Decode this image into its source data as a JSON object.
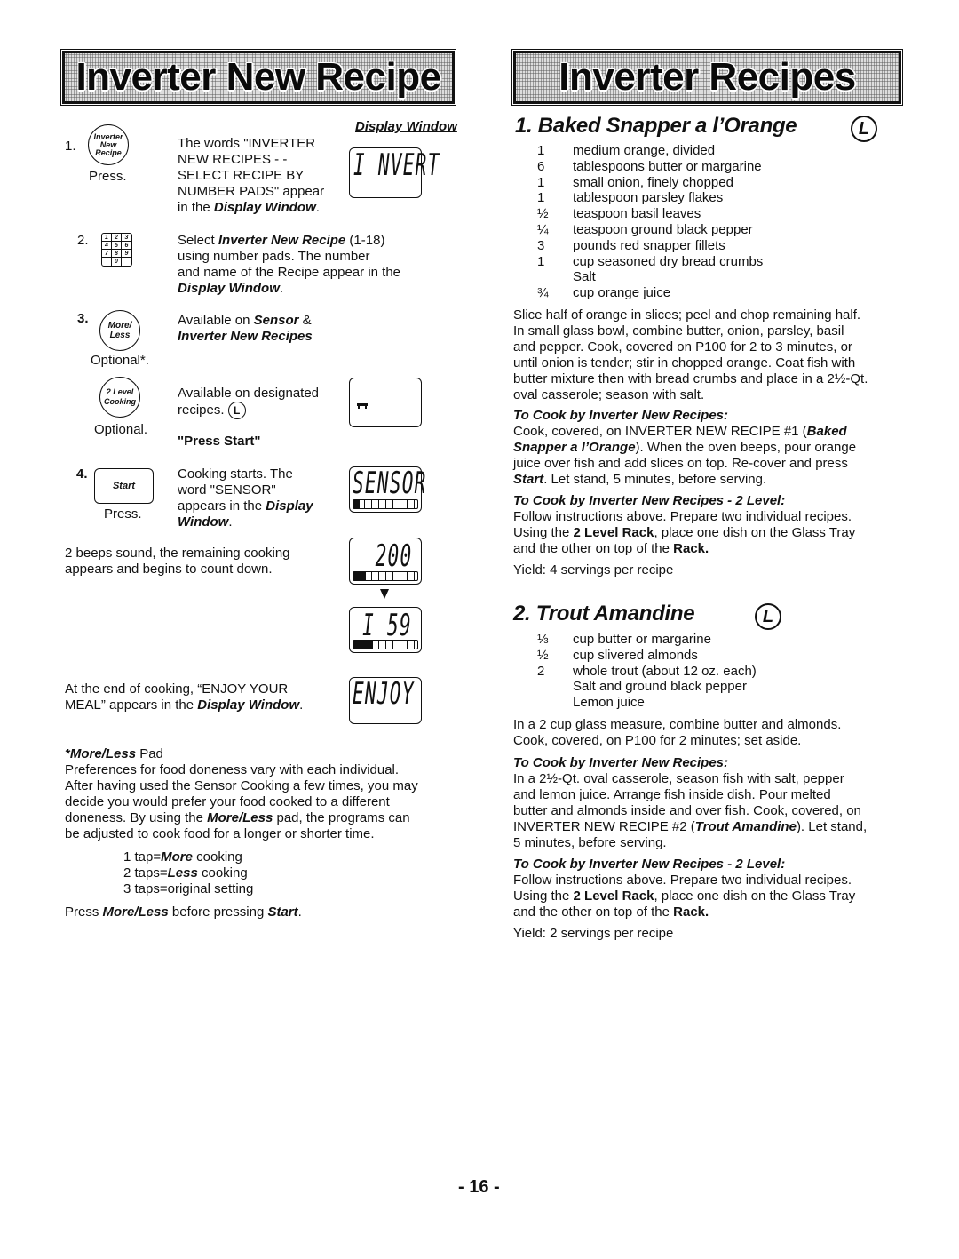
{
  "page_number": "- 16 -",
  "left": {
    "banner_title": "Inverter New Recipe",
    "display_window_heading": "Display Window",
    "steps": [
      {
        "number": "1.",
        "button_label_lines": [
          "Inverter",
          "New",
          "Recipe"
        ],
        "action": "Press.",
        "text_lines": [
          "The words \"INVERTER",
          "NEW RECIPES - -",
          "SELECT RECIPE BY",
          "NUMBER PADS\" appear"
        ],
        "text_tail_prefix": "in the ",
        "text_tail_emph": "Display Window",
        "text_tail_suffix": ".",
        "display": "I NVERT"
      },
      {
        "number": "2.",
        "keypad_keys": [
          "1",
          "2",
          "3",
          "4",
          "5",
          "6",
          "7",
          "8",
          "9",
          "",
          "0",
          ""
        ],
        "line1_prefix": "Select ",
        "line1_emph": "Inverter New Recipe",
        "line1_suffix": " (1-18)",
        "line2": "using number pads. The number",
        "line3": "and name of the Recipe appear in the",
        "line4_emph": "Display Window",
        "line4_suffix": "."
      },
      {
        "number": "3.",
        "button_label_lines": [
          "More/",
          "Less"
        ],
        "action": "Optional*.",
        "line1_prefix": "Available on ",
        "line1_emph": "Sensor",
        "line1_suffix": " &",
        "line2_emph": "Inverter New Recipes"
      },
      {
        "button_label_lines": [
          "2 Level",
          "Cooking"
        ],
        "action": "Optional.",
        "line1": "Available on designated",
        "line2": "recipes.",
        "icon": "L",
        "press_start": "\"Press Start\""
      },
      {
        "number": "4.",
        "button_label": "Start",
        "action": "Press.",
        "line1": "Cooking starts. The",
        "line2": "word \"SENSOR\"",
        "line3_prefix": "appears in the ",
        "line3_emph": "Display",
        "line4_emph": "Window",
        "line4_suffix": ".",
        "display": "SENSOR",
        "progress_fraction": 0.1
      }
    ],
    "countdown": {
      "line1": "2 beeps sound, the remaining cooking",
      "line2": "appears and begins to count down.",
      "display_first": "200",
      "display_first_progress": 0.2,
      "display_second": "I 59",
      "display_second_progress": 0.3
    },
    "end": {
      "line1": "At the end of cooking, “ENJOY YOUR",
      "line2_prefix": "MEAL” appears in the ",
      "line2_emph": "Display Window",
      "line2_suffix": ".",
      "display": "ENJOY"
    },
    "more_less": {
      "heading_emph": "*More/Less",
      "heading_suffix": " Pad",
      "para_lines": [
        "Preferences for food doneness vary with each individual.",
        "After having used the Sensor Cooking a few times, you may",
        "decide you would prefer your food cooked to a different"
      ],
      "para_line4_prefix": "doneness. By using the ",
      "para_line4_emph": "More/Less",
      "para_line4_suffix": " pad, the programs can",
      "para_line5": "be adjusted to cook food for a longer or shorter time.",
      "taps": [
        {
          "prefix": "1 tap=",
          "emph": "More",
          "suffix": " cooking"
        },
        {
          "prefix": "2 taps=",
          "emph": "Less",
          "suffix": " cooking"
        },
        {
          "prefix": "3 taps=original setting",
          "emph": "",
          "suffix": ""
        }
      ],
      "footer_prefix": "Press ",
      "footer_emph1": "More/Less",
      "footer_mid": " before pressing ",
      "footer_emph2": "Start",
      "footer_suffix": "."
    }
  },
  "right": {
    "banner_title": "Inverter Recipes",
    "recipes": [
      {
        "title": "1. Baked Snapper a l’Orange",
        "icon": "L",
        "ingredients": [
          {
            "qty": "1",
            "item": "medium orange, divided"
          },
          {
            "qty": "6",
            "item": "tablespoons butter or margarine"
          },
          {
            "qty": "1",
            "item": "small onion, finely chopped"
          },
          {
            "qty": "1",
            "item": "tablespoon parsley flakes"
          },
          {
            "qty": "½",
            "item": "teaspoon basil leaves"
          },
          {
            "qty": "¼",
            "item": "teaspoon ground black pepper"
          },
          {
            "qty": "3",
            "item": "pounds red snapper fillets"
          },
          {
            "qty": "1",
            "item": "cup seasoned dry bread crumbs"
          },
          {
            "qty": "",
            "item": "Salt"
          },
          {
            "qty": "¾",
            "item": "cup orange juice"
          }
        ],
        "directions": [
          "Slice half of orange in slices; peel and chop remaining half.",
          "In small glass bowl, combine butter, onion, parsley, basil",
          "and pepper. Cook, covered on P100 for 2 to 3 minutes, or",
          "until onion is tender; stir in chopped orange. Coat fish with",
          "butter mixture then with bread crumbs and place in a 2½-Qt.",
          "oval casserole; season with salt."
        ],
        "cook_heading": "To Cook by Inverter New Recipes:",
        "cook_line1_prefix": "Cook, covered, on INVERTER NEW RECIPE #1 (",
        "cook_line1_emph": "Baked",
        "cook_line2_emph": "Snapper a l’Orange",
        "cook_line2_suffix": ").  When the oven beeps, pour orange",
        "cook_line3": "juice over fish and add slices on top.  Re-cover and press",
        "cook_line4_emph": "Start",
        "cook_line4_suffix": ".  Let stand, 5 minutes, before serving.",
        "level_heading": "To Cook by Inverter New Recipes - 2 Level:",
        "level_line1": "Follow instructions above. Prepare two individual recipes.",
        "level_line2_prefix": "Using the ",
        "level_line2_emph": "2 Level Rack",
        "level_line2_suffix": ", place one dish on the Glass Tray",
        "level_line3_prefix": "and the other on top of the ",
        "level_line3_emph": "Rack.",
        "yield": "Yield: 4 servings per recipe"
      },
      {
        "title": "2. Trout Amandine",
        "icon": "L",
        "ingredients": [
          {
            "qty": "⅓",
            "item": "cup butter or margarine"
          },
          {
            "qty": "½",
            "item": "cup slivered almonds"
          },
          {
            "qty": "2",
            "item": "whole trout (about 12 oz. each)"
          },
          {
            "qty": "",
            "item": "Salt and ground black pepper"
          },
          {
            "qty": "",
            "item": "Lemon juice"
          }
        ],
        "directions": [
          "In a 2 cup glass measure, combine butter and almonds.",
          "Cook, covered, on P100 for 2 minutes; set aside."
        ],
        "cook_heading": "To Cook by Inverter New Recipes:",
        "cook_lines": [
          "In a 2½-Qt. oval casserole, season fish with salt, pepper",
          "and lemon juice.  Arrange fish inside dish.  Pour melted",
          "butter and almonds inside and over fish. Cook, covered, on"
        ],
        "cook_line4_prefix": "INVERTER NEW RECIPE #2 (",
        "cook_line4_emph": "Trout Amandine",
        "cook_line4_suffix": "). Let stand,",
        "cook_line5": "5 minutes, before serving.",
        "level_heading": "To Cook by Inverter New Recipes - 2 Level:",
        "level_line1": "Follow instructions above. Prepare two individual recipes.",
        "level_line2_prefix": "Using the ",
        "level_line2_emph": "2 Level Rack",
        "level_line2_suffix": ", place one dish on the Glass Tray",
        "level_line3_prefix": "and the other on top of the ",
        "level_line3_emph": "Rack.",
        "yield": "Yield: 2 servings per recipe"
      }
    ]
  }
}
